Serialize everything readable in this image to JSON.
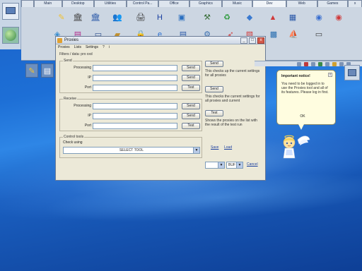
{
  "palette": {
    "tabs": [
      "Main",
      "Desktop",
      "Utilities",
      "Control Pa...",
      "Office",
      "Graphics",
      "Music",
      "Dev",
      "Web",
      "Games"
    ],
    "icons": [
      {
        "name": "edit-icon",
        "glyph": "✎",
        "color": "#f2c230"
      },
      {
        "name": "bank-icon",
        "glyph": "🏛",
        "color": "#444"
      },
      {
        "name": "bank-blue-icon",
        "glyph": "🏛",
        "color": "#2a58a8"
      },
      {
        "name": "people-icon",
        "glyph": "👥",
        "color": "#2a58a8"
      },
      {
        "name": "printer-icon",
        "glyph": "🖨",
        "color": "#3a3a3a"
      },
      {
        "name": "h-icon",
        "glyph": "H",
        "color": "#1a3fa0"
      },
      {
        "name": "window-icon",
        "glyph": "▣",
        "color": "#2a6fc0"
      },
      {
        "name": "tools-icon",
        "glyph": "⚒",
        "color": "#3a6f3a"
      },
      {
        "name": "recycle-icon",
        "glyph": "♻",
        "color": "#2a9a3a"
      },
      {
        "name": "cube-icon",
        "glyph": "◆",
        "color": "#3a7ad0"
      },
      {
        "name": "paint-icon",
        "glyph": "▲",
        "color": "#d03a3a"
      },
      {
        "name": "chart-icon",
        "glyph": "▦",
        "color": "#2a58a8"
      },
      {
        "name": "globe-icon",
        "glyph": "◉",
        "color": "#3a6fd0"
      },
      {
        "name": "world-icon",
        "glyph": "◉",
        "color": "#d03a3a"
      },
      {
        "name": "cubes-icon",
        "glyph": "◈",
        "color": "#3a8fd0"
      },
      {
        "name": "box-icon",
        "glyph": "▤",
        "color": "#b02a8a"
      },
      {
        "name": "monitor-icon",
        "glyph": "▭",
        "color": "#2a4a8a"
      },
      {
        "name": "folder-icon",
        "glyph": "▰",
        "color": "#c09030"
      },
      {
        "name": "lock-icon",
        "glyph": "🔒",
        "color": "#7a7a7a"
      },
      {
        "name": "ie-icon",
        "glyph": "e",
        "color": "#2a6fd0"
      },
      {
        "name": "doc-icon",
        "glyph": "▤",
        "color": "#2a58a8"
      },
      {
        "name": "gear-icon",
        "glyph": "⚙",
        "color": "#3a6fb0"
      },
      {
        "name": "rocket-icon",
        "glyph": "➶",
        "color": "#d03a3a"
      },
      {
        "name": "pages-icon",
        "glyph": "▧",
        "color": "#d03a3a"
      },
      {
        "name": "network-icon",
        "glyph": "▩",
        "color": "#2a6fb0"
      },
      {
        "name": "ship-icon",
        "glyph": "⛵",
        "color": "#3a3a8a"
      },
      {
        "name": "display-icon",
        "glyph": "▭",
        "color": "#3a3a3a"
      }
    ]
  },
  "window": {
    "title": "Proxies",
    "menu": [
      "Proxies",
      "Lists",
      "Settings",
      "?",
      "i"
    ],
    "section_label": "Filters / data: pro xxd",
    "group1": {
      "label": "Send",
      "fields": [
        {
          "label": "Processing",
          "value": "",
          "button": "Send"
        },
        {
          "label": "IP",
          "value": "",
          "button": "Send"
        },
        {
          "label": "Port",
          "value": "",
          "button": "Test"
        }
      ]
    },
    "group2": {
      "label": "Receive",
      "fields": [
        {
          "label": "Processing",
          "value": "",
          "button": "Send"
        },
        {
          "label": "IP",
          "value": "",
          "button": "Send"
        },
        {
          "label": "Port",
          "value": "",
          "button": "Test"
        }
      ]
    },
    "group3": {
      "label": "Control tools",
      "select_label": "Check using",
      "select_value": "SELECT TOOL"
    },
    "right": {
      "btn1": "Send",
      "desc1": "This checks up the current settings for all proxies",
      "btn2": "Send",
      "desc2": "This checks the current settings for all proxies and current",
      "btn3": "Test",
      "desc3": "Shows the proxies on the list with the result of the test run",
      "link1": "Save",
      "link2": "Load",
      "mini_select": "BUF",
      "close_link": "Cancel"
    }
  },
  "notification": {
    "title": "Important notice!",
    "body": "You need to be logged in to use the Proxies tool and all of its features. Please log in first.",
    "ok": "OK",
    "close": "x"
  }
}
